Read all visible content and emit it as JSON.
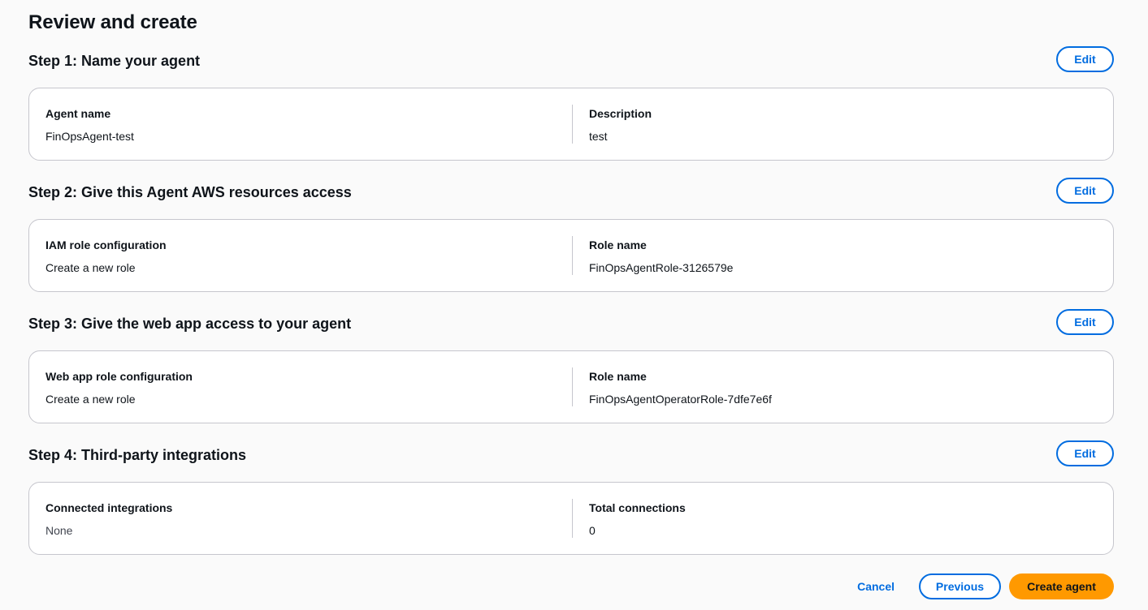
{
  "page": {
    "title": "Review and create"
  },
  "steps": [
    {
      "title": "Step 1: Name your agent",
      "edit_label": "Edit",
      "left": {
        "label": "Agent name",
        "value": "FinOpsAgent-test"
      },
      "right": {
        "label": "Description",
        "value": "test"
      }
    },
    {
      "title": "Step 2: Give this Agent AWS resources access",
      "edit_label": "Edit",
      "left": {
        "label": "IAM role configuration",
        "value": "Create a new role"
      },
      "right": {
        "label": "Role name",
        "value": "FinOpsAgentRole-3126579e"
      }
    },
    {
      "title": "Step 3: Give the web app access to your agent",
      "edit_label": "Edit",
      "left": {
        "label": "Web app role configuration",
        "value": "Create a new role"
      },
      "right": {
        "label": "Role name",
        "value": "FinOpsAgentOperatorRole-7dfe7e6f"
      }
    },
    {
      "title": "Step 4: Third-party integrations",
      "edit_label": "Edit",
      "left": {
        "label": "Connected integrations",
        "value": "None"
      },
      "right": {
        "label": "Total connections",
        "value": "0"
      }
    }
  ],
  "footer": {
    "cancel_label": "Cancel",
    "previous_label": "Previous",
    "create_label": "Create agent"
  },
  "colors": {
    "accent": "#006ce0",
    "primary_button": "#ff9900",
    "border": "#c6c6cd",
    "background": "#fafafa"
  }
}
